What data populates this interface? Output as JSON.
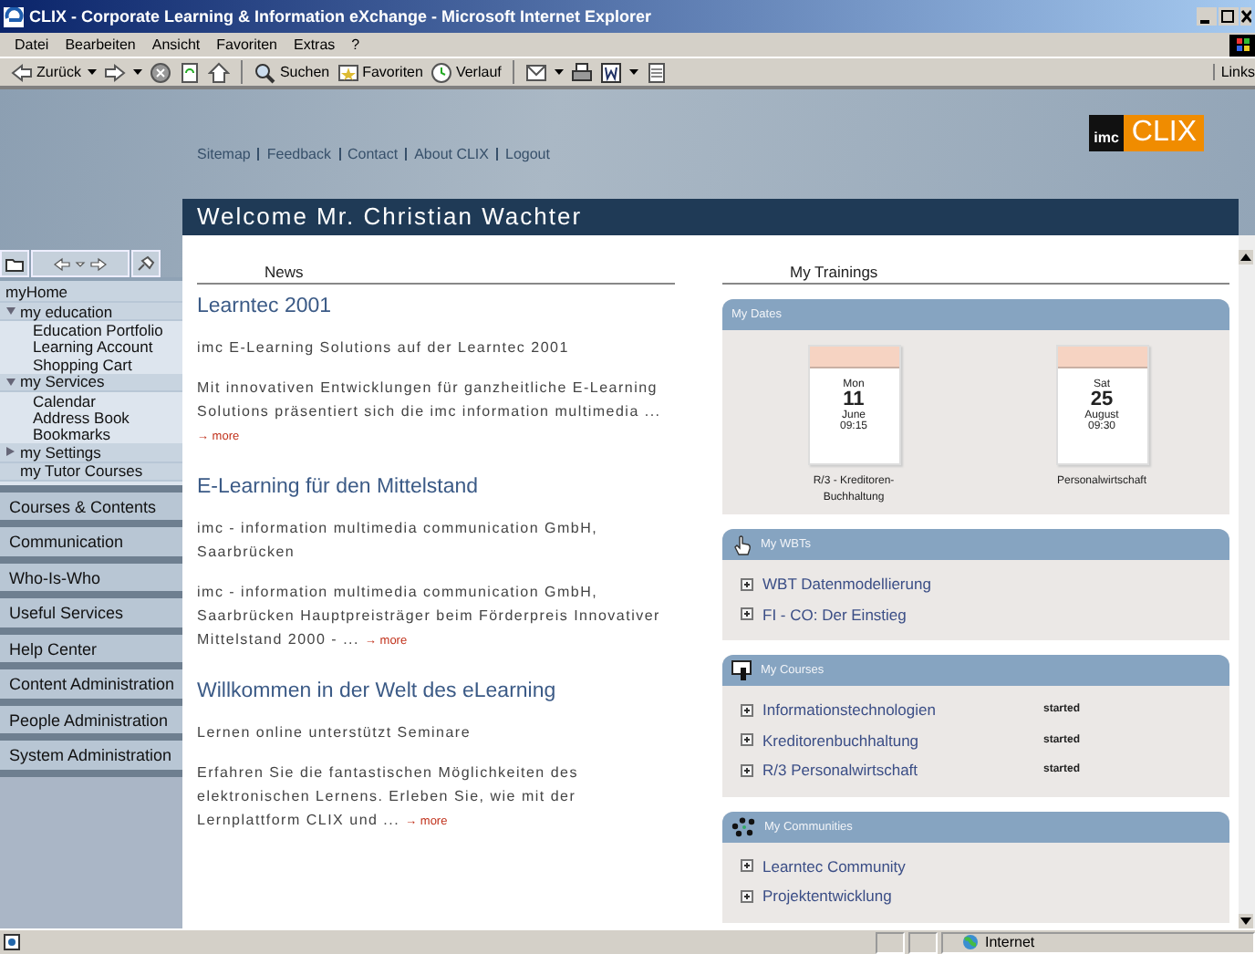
{
  "window": {
    "title": "CLIX - Corporate Learning & Information eXchange - Microsoft Internet Explorer"
  },
  "menu": [
    "Datei",
    "Bearbeiten",
    "Ansicht",
    "Favoriten",
    "Extras",
    "?"
  ],
  "toolbar": [
    {
      "kind": "back",
      "label": "Zurück"
    },
    {
      "kind": "forward"
    },
    {
      "kind": "stop"
    },
    {
      "kind": "refresh"
    },
    {
      "kind": "home"
    },
    {
      "kind": "search",
      "label": "Suchen"
    },
    {
      "kind": "favorites",
      "label": "Favoriten"
    },
    {
      "kind": "history",
      "label": "Verlauf"
    },
    {
      "kind": "mail"
    },
    {
      "kind": "print"
    },
    {
      "kind": "word"
    },
    {
      "kind": "discuss"
    }
  ],
  "links_label": "Links",
  "top_links": [
    "Sitemap",
    "Feedback",
    "Contact",
    "About CLIX",
    "Logout"
  ],
  "logo": {
    "mark": "imc",
    "name": "CLIX"
  },
  "welcome": "Welcome Mr. Christian Wachter",
  "sidebar": {
    "tree": [
      {
        "label": "myHome"
      },
      {
        "label": "my education",
        "expanded": true,
        "children": [
          {
            "label": "Education Portfolio"
          },
          {
            "label": "Learning Account"
          },
          {
            "label": "Shopping Cart"
          }
        ]
      },
      {
        "label": "my Services",
        "expanded": true,
        "children": [
          {
            "label": "Calendar"
          },
          {
            "label": "Address Book"
          },
          {
            "label": "Bookmarks"
          }
        ]
      },
      {
        "label": "my Settings",
        "expanded": false
      },
      {
        "label": "my Tutor Courses"
      }
    ],
    "sections": [
      "Courses & Contents",
      "Communication",
      "Who-Is-Who",
      "Useful Services",
      "Help Center",
      "Content Administration",
      "People Administration",
      "System Administration"
    ]
  },
  "news": {
    "heading": "News",
    "items": [
      {
        "title": "Learntec 2001",
        "paragraphs": [
          "imc E-Learning Solutions auf der Learntec 2001",
          "Mit innovativen Entwicklungen für ganzheitliche E-Learning Solutions präsentiert sich die imc information multimedia ..."
        ],
        "more": "→ more"
      },
      {
        "title": "E-Learning für den Mittelstand",
        "paragraphs": [
          "imc - information multimedia communication GmbH, Saarbrücken",
          "imc - information multimedia communication GmbH, Saarbrücken Hauptpreisträger beim Förderpreis Innovativer Mittelstand 2000 - ..."
        ],
        "more": "→ more"
      },
      {
        "title": "Willkommen in der Welt des eLearning",
        "paragraphs": [
          "Lernen online unterstützt Seminare",
          "Erfahren Sie die fantastischen Möglichkeiten des elektronischen Lernens. Erleben Sie, wie mit der Lernplattform CLIX und ..."
        ],
        "more": "→ more"
      }
    ]
  },
  "trainings": {
    "heading": "My Trainings",
    "panels": [
      {
        "kind": "dates",
        "title": "My Dates",
        "dates": [
          {
            "weekday": "Mon",
            "day": "11",
            "month": "June",
            "time": "09:15",
            "caption": "R/3 - Kreditoren-Buchhaltung"
          },
          {
            "weekday": "Sat",
            "day": "25",
            "month": "August",
            "time": "09:30",
            "caption": "Personalwirtschaft"
          }
        ]
      },
      {
        "kind": "wbts",
        "title": "My WBTs",
        "items": [
          {
            "name": "WBT Datenmodellierung"
          },
          {
            "name": "FI - CO: Der Einstieg"
          }
        ]
      },
      {
        "kind": "courses",
        "title": "My Courses",
        "items": [
          {
            "name": "Informationstechnologien",
            "status": "started"
          },
          {
            "name": "Kreditorenbuchhaltung",
            "status": "started"
          },
          {
            "name": "R/3 Personalwirtschaft",
            "status": "started"
          }
        ]
      },
      {
        "kind": "communities",
        "title": "My Communities",
        "items": [
          {
            "name": "Learntec Community"
          },
          {
            "name": "Projektentwicklung"
          }
        ]
      }
    ]
  },
  "status_bar": {
    "zone": "Internet"
  }
}
